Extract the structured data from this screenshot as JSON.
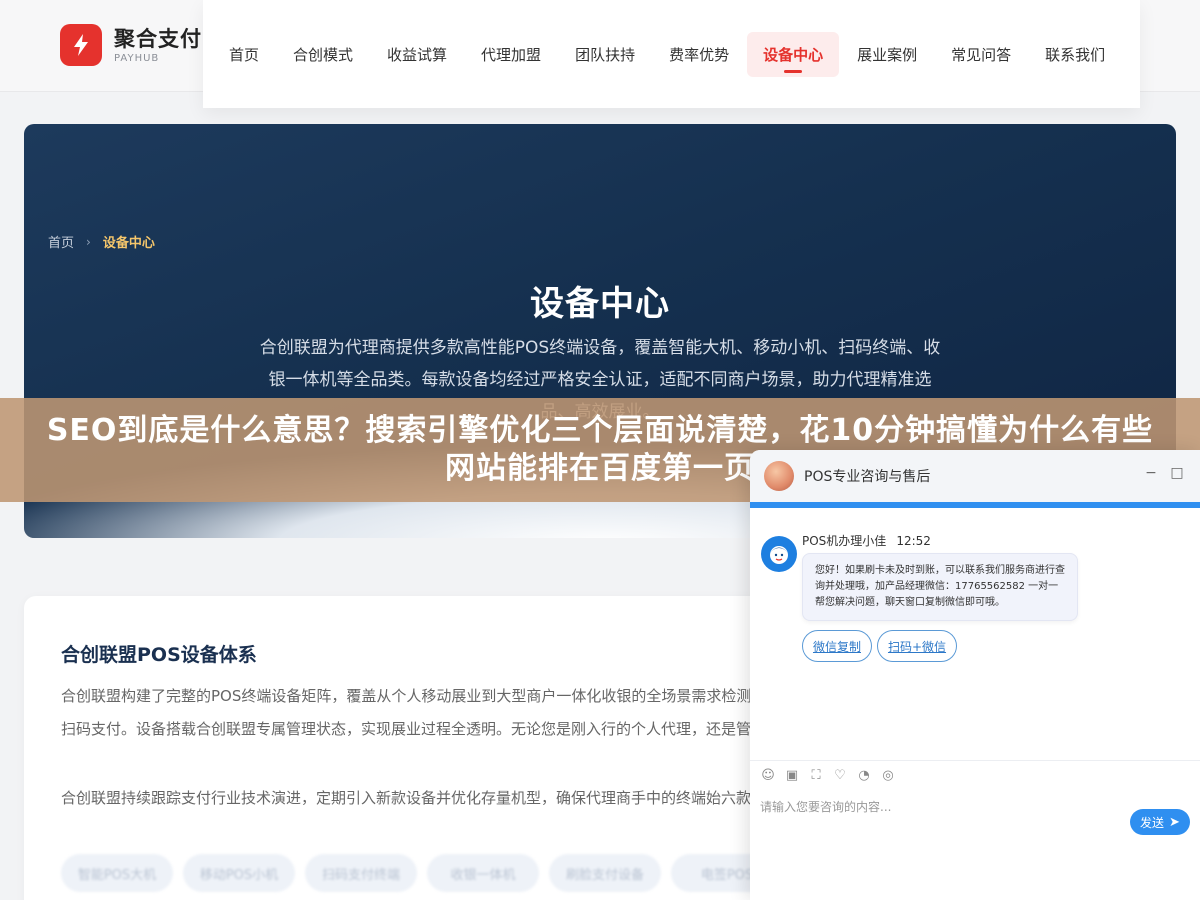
{
  "header": {
    "brand_name": "聚合支付",
    "brand_sub": "PAYHUB",
    "nav": [
      "首页",
      "合创模式",
      "收益试算",
      "代理加盟",
      "团队扶持",
      "费率优势",
      "设备中心",
      "展业案例",
      "常见问答",
      "联系我们"
    ],
    "active_nav": "设备中心"
  },
  "hero": {
    "breadcrumb_home": "首页",
    "breadcrumb_sep": "›",
    "breadcrumb_current": "设备中心",
    "title": "设备中心",
    "description": "合创联盟为代理商提供多款高性能POS终端设备，覆盖智能大机、移动小机、扫码终端、收银一体机等全品类。每款设备均经过严格安全认证，适配不同商户场景，助力代理精准选品、高效展业。"
  },
  "banner": {
    "text": "SEO到底是什么意思？搜索引擎优化三个层面说清楚，花10分钟搞懂为什么有些网站能排在百度第一页"
  },
  "content": {
    "title": "合创联盟POS设备体系",
    "p1": "合创联盟构建了完整的POS终端设备矩阵，覆盖从个人移动展业到大型商户一体化收银的全场景需求检测，支持磁条卡、IC芯片卡、NFC非接触闪付及主流二维码扫码支付。设备搭载合创联盟专属管理状态，实现展业过程全透明。无论您是刚入行的个人代理，还是管理百人团队的团队长，都能在设备",
    "p2": "合创联盟持续跟踪支付行业技术演进，定期引入新款设备并优化存量机型，确保代理商手中的终端始六款核心设备。",
    "tags": [
      "智能POS大机",
      "移动POS小机",
      "扫码支付终端",
      "收银一体机",
      "刷脸支付设备",
      "电签POS"
    ]
  },
  "chat": {
    "title": "POS专业咨询与售后",
    "minimize": "−",
    "close": "□",
    "agent_name": "POS机办理小佳",
    "time": "12:52",
    "message": "您好！如果刷卡未及时到账，可以联系我们服务商进行查询并处理哦，加产品经理微信：17765562582 一对一帮您解决问题，聊天窗口复制微信即可哦。",
    "quick_replies": [
      "微信复制",
      "扫码+微信"
    ],
    "input_placeholder": "请输入您要咨询的内容...",
    "send_label": "发送"
  },
  "colors": {
    "brand_red": "#e5322d",
    "hero_navy": "#15304f",
    "chat_blue": "#2f8ff0"
  }
}
